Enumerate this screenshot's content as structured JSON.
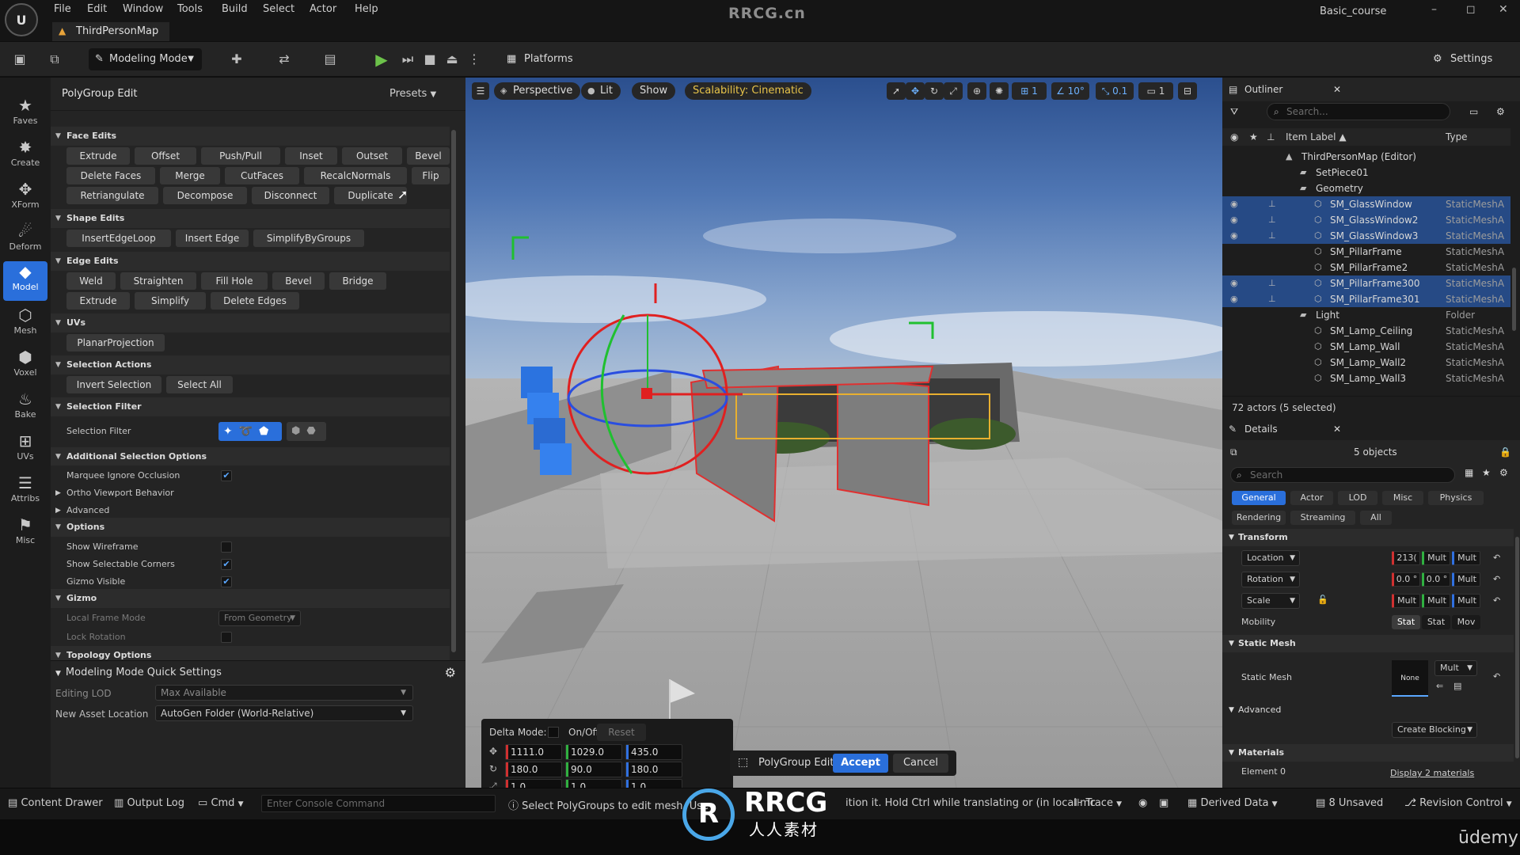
{
  "window": {
    "brand": "RRCG.cn",
    "project": "Basic_course",
    "logo": "U",
    "controls": [
      "–",
      "◻",
      "✕"
    ]
  },
  "menu": [
    "File",
    "Edit",
    "Window",
    "Tools",
    "Build",
    "Select",
    "Actor",
    "Help"
  ],
  "tabs": {
    "map": "ThirdPersonMap"
  },
  "toolbar": {
    "mode": "Modeling Mode",
    "platforms": "Platforms",
    "settings": "Settings"
  },
  "modes": [
    "Faves",
    "Create",
    "XForm",
    "Deform",
    "Model",
    "Mesh",
    "Voxel",
    "Bake",
    "UVs",
    "Attribs",
    "Misc"
  ],
  "tool": {
    "title": "PolyGroup Edit",
    "presets": "Presets",
    "face_edits": {
      "title": "Face Edits",
      "row1": [
        "Extrude",
        "Offset",
        "Push/Pull",
        "Inset",
        "Outset",
        "Bevel"
      ],
      "row2": [
        "Delete Faces",
        "Merge",
        "CutFaces",
        "RecalcNormals",
        "Flip"
      ],
      "row3": [
        "Retriangulate",
        "Decompose",
        "Disconnect",
        "Duplicate"
      ]
    },
    "shape_edits": {
      "title": "Shape Edits",
      "row1": [
        "InsertEdgeLoop",
        "Insert Edge",
        "SimplifyByGroups"
      ]
    },
    "edge_edits": {
      "title": "Edge Edits",
      "row1": [
        "Weld",
        "Straighten",
        "Fill Hole",
        "Bevel",
        "Bridge"
      ],
      "row2": [
        "Extrude",
        "Simplify",
        "Delete Edges"
      ]
    },
    "uvs": {
      "title": "UVs",
      "row1": [
        "PlanarProjection"
      ]
    },
    "selection_actions": {
      "title": "Selection Actions",
      "row1": [
        "Invert Selection",
        "Select All"
      ]
    },
    "selection_filter": {
      "title": "Selection Filter",
      "label": "Selection Filter"
    },
    "additional": {
      "title": "Additional Selection Options",
      "marquee": "Marquee Ignore Occlusion",
      "ortho": "Ortho Viewport Behavior",
      "advanced": "Advanced"
    },
    "options": {
      "title": "Options",
      "wireframe": "Show Wireframe",
      "corners": "Show Selectable Corners",
      "gizmo": "Gizmo Visible"
    },
    "gizmo": {
      "title": "Gizmo",
      "frame_mode": "Local Frame Mode",
      "frame_value": "From Geometry",
      "lock": "Lock Rotation"
    },
    "topology": {
      "title": "Topology Options"
    },
    "quick": {
      "title": "Modeling Mode Quick Settings",
      "lod_label": "Editing LOD",
      "lod_value": "Max Available",
      "asset_label": "New Asset Location",
      "asset_value": "AutoGen Folder (World-Relative)"
    }
  },
  "viewport": {
    "perspective": "Perspective",
    "lit": "Lit",
    "show": "Show",
    "scalability": "Scalability: Cinematic",
    "grid": "1",
    "angle": "10°",
    "scale": "0.1",
    "cam": "1",
    "delta": {
      "mode_label": "Delta Mode:",
      "onoff": "On/Off",
      "reset": "Reset",
      "loc": [
        "1111.0",
        "1029.0",
        "435.0"
      ],
      "rot": [
        "180.0",
        "90.0",
        "180.0"
      ],
      "scale": [
        "1.0",
        "1.0",
        "1.0"
      ]
    },
    "pg_label": "PolyGroup Edit",
    "accept": "Accept",
    "cancel": "Cancel"
  },
  "outliner": {
    "title": "Outliner",
    "search": "Search...",
    "col_label": "Item Label",
    "col_type": "Type",
    "rows": [
      {
        "name": "ThirdPersonMap (Editor)",
        "type": "",
        "indent": 0,
        "sel": false,
        "vis": false
      },
      {
        "name": "SetPiece01",
        "type": "",
        "indent": 1,
        "sel": false,
        "vis": false
      },
      {
        "name": "Geometry",
        "type": "",
        "indent": 1,
        "sel": false,
        "vis": false
      },
      {
        "name": "SM_GlassWindow",
        "type": "StaticMeshA",
        "indent": 2,
        "sel": true,
        "vis": true
      },
      {
        "name": "SM_GlassWindow2",
        "type": "StaticMeshA",
        "indent": 2,
        "sel": true,
        "vis": true
      },
      {
        "name": "SM_GlassWindow3",
        "type": "StaticMeshA",
        "indent": 2,
        "sel": true,
        "vis": true
      },
      {
        "name": "SM_PillarFrame",
        "type": "StaticMeshA",
        "indent": 2,
        "sel": false,
        "vis": false
      },
      {
        "name": "SM_PillarFrame2",
        "type": "StaticMeshA",
        "indent": 2,
        "sel": false,
        "vis": false
      },
      {
        "name": "SM_PillarFrame300",
        "type": "StaticMeshA",
        "indent": 2,
        "sel": true,
        "vis": true
      },
      {
        "name": "SM_PillarFrame301",
        "type": "StaticMeshA",
        "indent": 2,
        "sel": true,
        "vis": true
      },
      {
        "name": "Light",
        "type": "Folder",
        "indent": 1,
        "sel": false,
        "vis": false
      },
      {
        "name": "SM_Lamp_Ceiling",
        "type": "StaticMeshA",
        "indent": 2,
        "sel": false,
        "vis": false
      },
      {
        "name": "SM_Lamp_Wall",
        "type": "StaticMeshA",
        "indent": 2,
        "sel": false,
        "vis": false
      },
      {
        "name": "SM_Lamp_Wall2",
        "type": "StaticMeshA",
        "indent": 2,
        "sel": false,
        "vis": false
      },
      {
        "name": "SM_Lamp_Wall3",
        "type": "StaticMeshA",
        "indent": 2,
        "sel": false,
        "vis": false
      }
    ],
    "footer": "72 actors (5 selected)"
  },
  "details": {
    "title": "Details",
    "objects": "5 objects",
    "search": "Search",
    "tabs1": [
      "General",
      "Actor",
      "LOD",
      "Misc",
      "Physics"
    ],
    "tabs2": [
      "Rendering",
      "Streaming",
      "All"
    ],
    "transform": "Transform",
    "location": "Location",
    "rotation": "Rotation",
    "scale": "Scale",
    "loc_vals": [
      "213(",
      "Mult",
      "Mult"
    ],
    "rot_vals": [
      "0.0 °",
      "0.0 °",
      "Mult"
    ],
    "scale_vals": [
      "Mult",
      "Mult",
      "Mult"
    ],
    "mobility": "Mobility",
    "mob_opts": [
      "Stat",
      "Stat",
      "Mov"
    ],
    "static_mesh_sec": "Static Mesh",
    "static_mesh": "Static Mesh",
    "sm_none": "None",
    "sm_mult": "Mult",
    "advanced": "Advanced",
    "create_blocking": "Create Blocking",
    "materials": "Materials",
    "element0": "Element 0",
    "display_mats": "Display 2 materials"
  },
  "status": {
    "content_drawer": "Content Drawer",
    "output_log": "Output Log",
    "cmd": "Cmd",
    "console": "Enter Console Command",
    "hint": "Select PolyGroups to edit mesh. Use",
    "hint2": "ition it. Hold Ctrl while translating or (in local mc",
    "trace": "Trace",
    "derived": "Derived Data",
    "unsaved": "8 Unsaved",
    "revision": "Revision Control"
  },
  "watermark": {
    "mark": "R",
    "name": "RRCG",
    "sub": "人人素材",
    "udemy": "ūdemy"
  }
}
